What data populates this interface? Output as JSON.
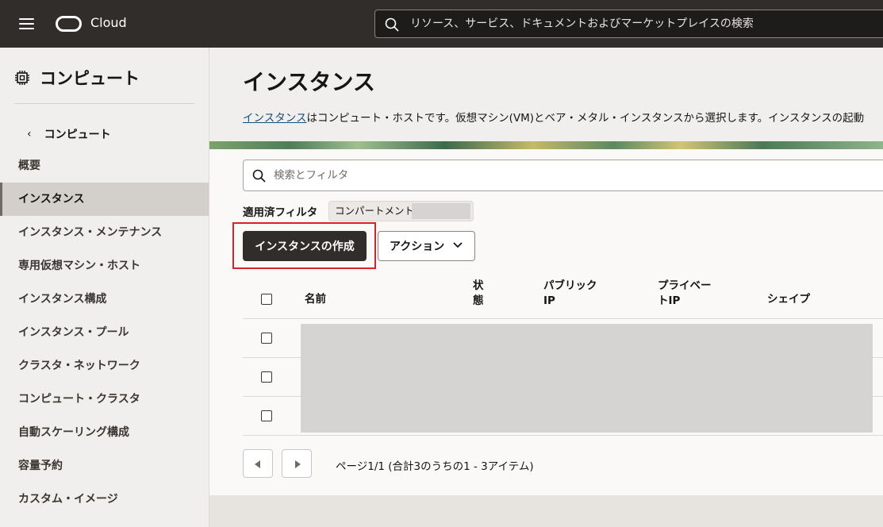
{
  "header": {
    "brand": "Cloud",
    "search_placeholder": "リソース、サービス、ドキュメントおよびマーケットプレイスの検索"
  },
  "sidebar": {
    "title": "コンピュート",
    "back_label": "コンピュート",
    "items": [
      {
        "label": "概要",
        "active": false
      },
      {
        "label": "インスタンス",
        "active": true
      },
      {
        "label": "インスタンス・メンテナンス",
        "active": false
      },
      {
        "label": "専用仮想マシン・ホスト",
        "active": false
      },
      {
        "label": "インスタンス構成",
        "active": false
      },
      {
        "label": "インスタンス・プール",
        "active": false
      },
      {
        "label": "クラスタ・ネットワーク",
        "active": false
      },
      {
        "label": "コンピュート・クラスタ",
        "active": false
      },
      {
        "label": "自動スケーリング構成",
        "active": false
      },
      {
        "label": "容量予約",
        "active": false
      },
      {
        "label": "カスタム・イメージ",
        "active": false
      }
    ]
  },
  "main": {
    "title": "インスタンス",
    "desc_link": "インスタンス",
    "desc_text": "はコンピュート・ホストです。仮想マシン(VM)とベア・メタル・インスタンスから選択します。インスタンスの起動",
    "filter_placeholder": "検索とフィルタ",
    "applied_filters_label": "適用済フィルタ",
    "applied_filter_chip": "コンパートメント",
    "create_button": "インスタンスの作成",
    "actions_button": "アクション",
    "table": {
      "columns": {
        "name": "名前",
        "state_line1": "状",
        "state_line2": "態",
        "public_ip_line1": "パブリック",
        "public_ip_line2": "IP",
        "private_ip_line1": "プライベー",
        "private_ip_line2": "トIP",
        "shape": "シェイプ"
      },
      "row_count": 3
    },
    "pagination": "ページ1/1 (合計3のうちの1 - 3アイテム)"
  }
}
